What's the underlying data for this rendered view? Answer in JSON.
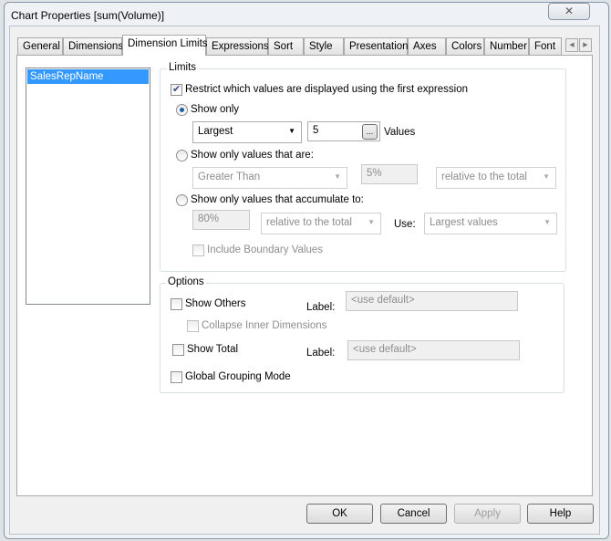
{
  "window": {
    "title": "Chart Properties [sum(Volume)]",
    "close_icon": "close-icon"
  },
  "tabs": [
    "General",
    "Dimensions",
    "Dimension Limits",
    "Expressions",
    "Sort",
    "Style",
    "Presentation",
    "Axes",
    "Colors",
    "Number",
    "Font"
  ],
  "active_tab": "Dimension Limits",
  "dimensions": [
    "SalesRepName"
  ],
  "limits": {
    "group_label": "Limits",
    "restrict_label": "Restrict which values are displayed using the first expression",
    "restrict_checked": true,
    "show_only_label": "Show only",
    "show_only_selected": true,
    "show_only_mode": "Largest",
    "show_only_count": "5",
    "ellipsis": "...",
    "values_label": "Values",
    "values_that_are_label": "Show only values that are:",
    "comparison": "Greater Than",
    "comparison_value": "5%",
    "comparison_relative": "relative to the total",
    "accumulate_label": "Show only values that accumulate to:",
    "accumulate_value": "80%",
    "accumulate_relative": "relative to the total",
    "use_label": "Use:",
    "use_value": "Largest values",
    "boundary_label": "Include Boundary Values"
  },
  "options": {
    "group_label": "Options",
    "show_others": "Show Others",
    "label1": "Label:",
    "others_placeholder": "<use default>",
    "collapse": "Collapse Inner Dimensions",
    "show_total": "Show Total",
    "label2": "Label:",
    "total_placeholder": "<use default>",
    "global_grouping": "Global Grouping Mode"
  },
  "buttons": {
    "ok": "OK",
    "cancel": "Cancel",
    "apply": "Apply",
    "help": "Help"
  }
}
